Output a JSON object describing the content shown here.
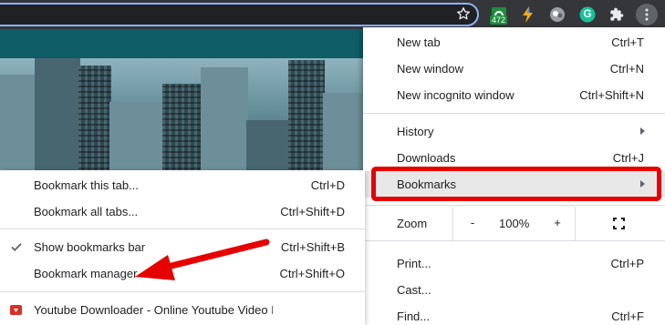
{
  "toolbar": {
    "extensions": [
      {
        "name": "extension-472-icon",
        "badge": "472"
      },
      {
        "name": "lightning-extension-icon"
      },
      {
        "name": "profile-extension-icon"
      },
      {
        "name": "grammarly-icon",
        "glyph": "G"
      },
      {
        "name": "puzzle-extensions-icon"
      },
      {
        "name": "kebab-menu-icon"
      }
    ],
    "badge_text": "472",
    "grammarly_glyph": "G",
    "colors": {
      "toolbar_bg": "#35363a",
      "omnibox_border": "#8ab4f8",
      "page_header": "#0e5d67"
    }
  },
  "main_menu": {
    "items": [
      {
        "label": "New tab",
        "shortcut": "Ctrl+T"
      },
      {
        "label": "New window",
        "shortcut": "Ctrl+N"
      },
      {
        "label": "New incognito window",
        "shortcut": "Ctrl+Shift+N"
      },
      {
        "label": "History",
        "submenu": true
      },
      {
        "label": "Downloads",
        "shortcut": "Ctrl+J"
      },
      {
        "label": "Bookmarks",
        "submenu": true,
        "highlighted": true
      },
      {
        "label": "Print...",
        "shortcut": "Ctrl+P"
      },
      {
        "label": "Cast..."
      },
      {
        "label": "Find...",
        "shortcut": "Ctrl+F"
      }
    ],
    "zoom": {
      "label": "Zoom",
      "minus": "-",
      "value": "100%",
      "plus": "+"
    }
  },
  "bookmarks_submenu": {
    "items": [
      {
        "label": "Bookmark this tab...",
        "shortcut": "Ctrl+D"
      },
      {
        "label": "Bookmark all tabs...",
        "shortcut": "Ctrl+Shift+D"
      },
      {
        "label": "Show bookmarks bar",
        "shortcut": "Ctrl+Shift+B",
        "checked": true
      },
      {
        "label": "Bookmark manager",
        "shortcut": "Ctrl+Shift+O"
      },
      {
        "label": "Youtube Downloader - Online Youtube Video D"
      }
    ]
  },
  "annotation": {
    "highlight_color": "#e60000"
  }
}
